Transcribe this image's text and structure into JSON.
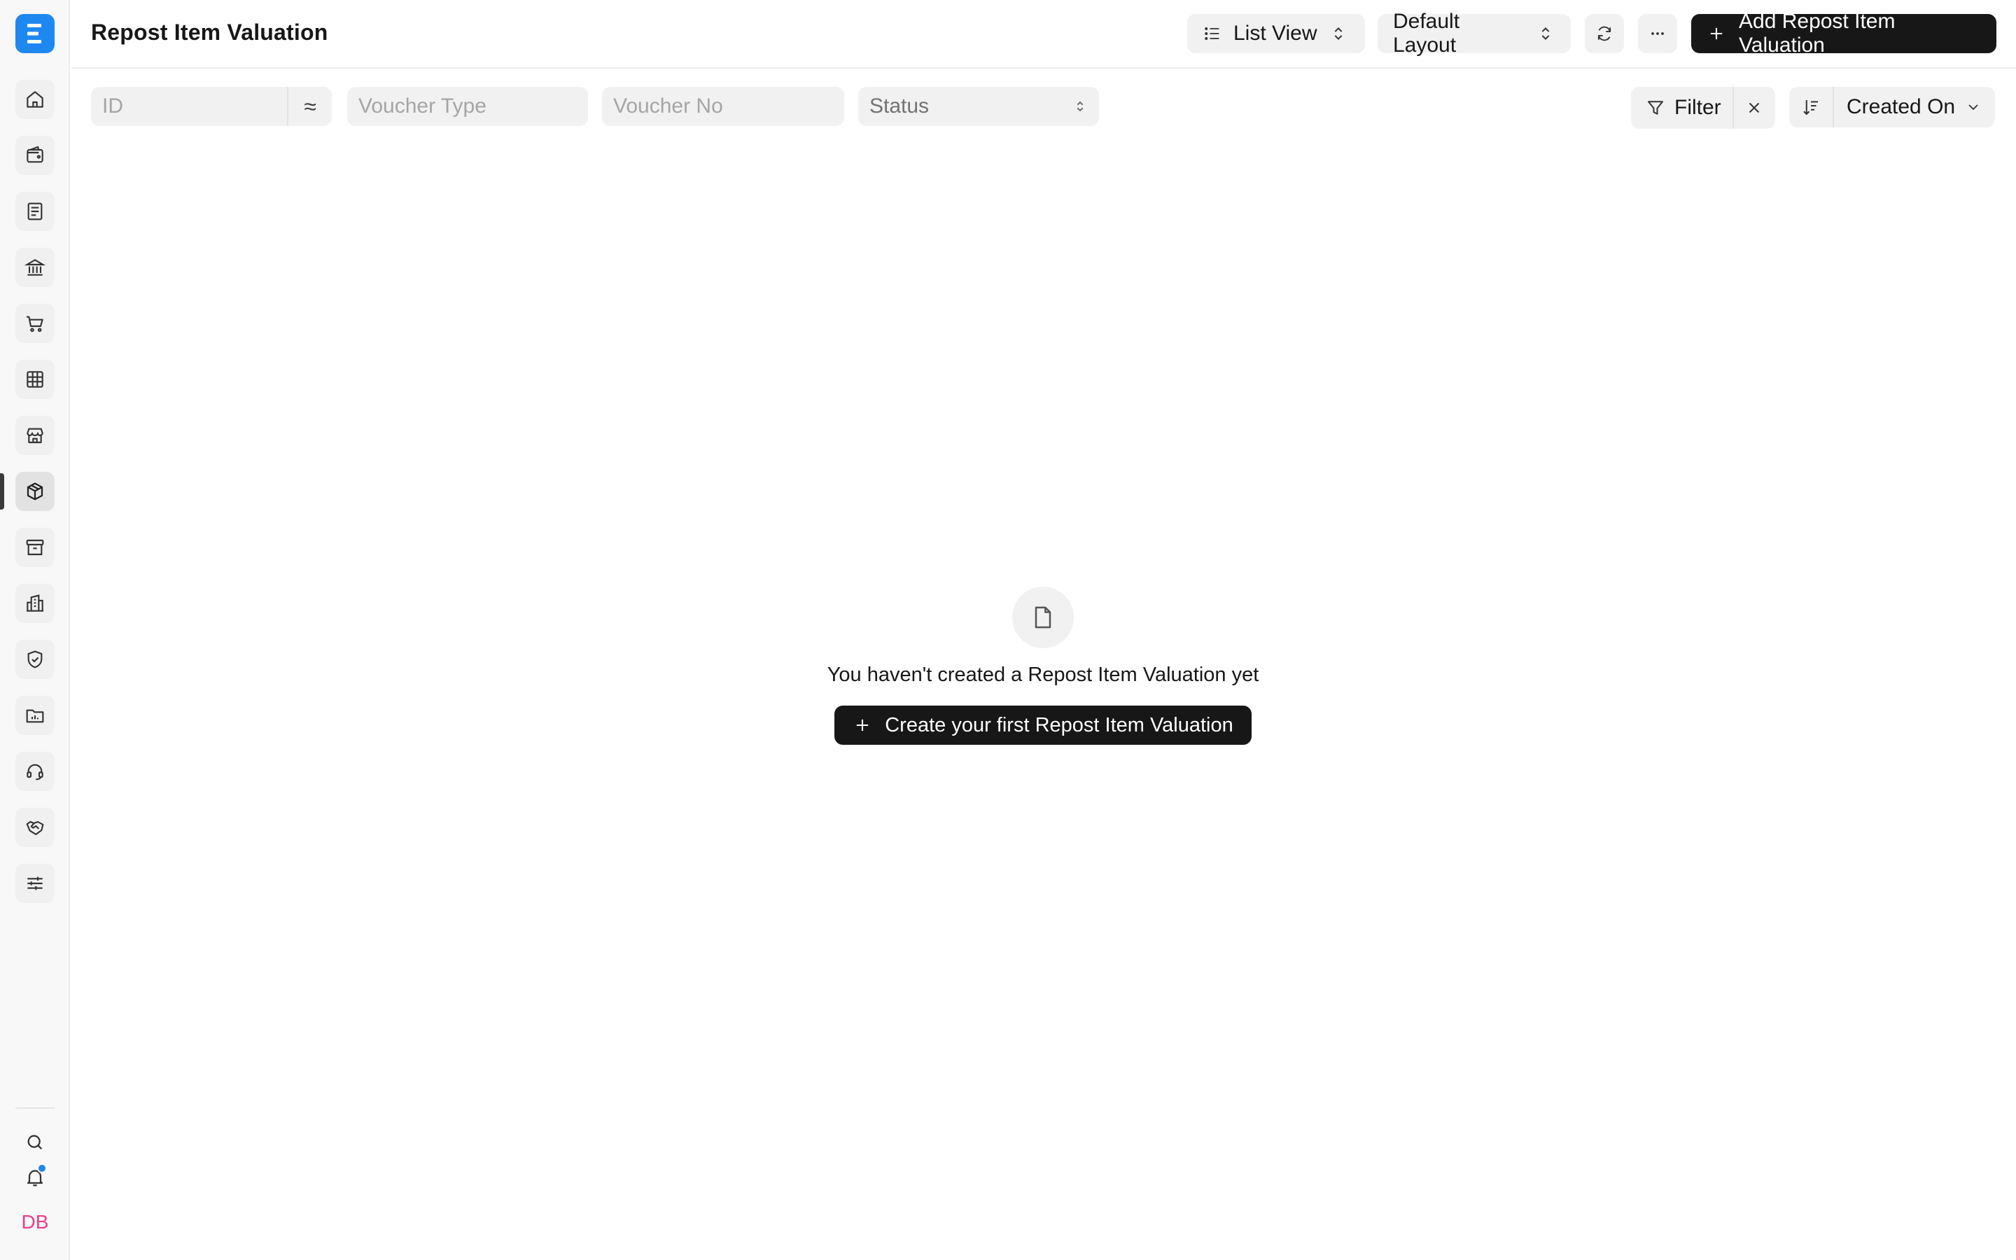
{
  "app": {
    "logo_letter": "E",
    "brand_color": "#1e88f0"
  },
  "sidebar": {
    "items": [
      {
        "name": "home",
        "icon": "home-icon"
      },
      {
        "name": "accounting",
        "icon": "wallet-icon"
      },
      {
        "name": "invoicing",
        "icon": "receipt-icon"
      },
      {
        "name": "banking",
        "icon": "bank-icon"
      },
      {
        "name": "buying",
        "icon": "cart-icon"
      },
      {
        "name": "selling",
        "icon": "table-icon"
      },
      {
        "name": "retail",
        "icon": "store-icon"
      },
      {
        "name": "stock",
        "icon": "package-icon",
        "active": true
      },
      {
        "name": "assets",
        "icon": "archive-icon"
      },
      {
        "name": "organization",
        "icon": "building-icon"
      },
      {
        "name": "quality",
        "icon": "shield-check-icon"
      },
      {
        "name": "projects",
        "icon": "folder-chart-icon"
      },
      {
        "name": "support",
        "icon": "headset-icon"
      },
      {
        "name": "crm",
        "icon": "handshake-icon"
      },
      {
        "name": "settings",
        "icon": "sliders-icon"
      }
    ],
    "bottom": {
      "search_icon": "search-icon",
      "notification_icon": "bell-icon",
      "avatar_initials": "DB"
    }
  },
  "header": {
    "title": "Repost Item Valuation",
    "view_label": "List View",
    "layout_label": "Default Layout",
    "add_label": "Add Repost Item Valuation"
  },
  "filters": {
    "id_placeholder": "ID",
    "id_operator": "≈",
    "voucher_type_placeholder": "Voucher Type",
    "voucher_no_placeholder": "Voucher No",
    "status_placeholder": "Status",
    "filter_label": "Filter",
    "sort_label": "Created On"
  },
  "empty_state": {
    "message": "You haven't created a Repost Item Valuation yet",
    "cta_label": "Create your first Repost Item Valuation"
  }
}
